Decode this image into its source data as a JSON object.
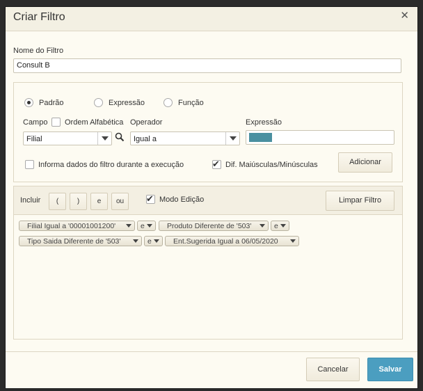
{
  "dialog": {
    "title": "Criar Filtro",
    "close": "✕"
  },
  "name_field": {
    "label": "Nome do Filtro",
    "value": "Consult B"
  },
  "mode_radios": [
    {
      "label": "Padrão",
      "checked": true
    },
    {
      "label": "Expressão",
      "checked": false
    },
    {
      "label": "Função",
      "checked": false
    }
  ],
  "campo": {
    "label": "Campo",
    "value": "Filial"
  },
  "ordem_alfabetica": {
    "label": "Ordem Alfabética",
    "checked": false
  },
  "operador": {
    "label": "Operador",
    "value": "Igual a"
  },
  "expressao": {
    "label": "Expressão",
    "swatch_color": "#4a90a0"
  },
  "options": {
    "informa": {
      "label": "Informa dados do filtro durante a execução",
      "checked": false
    },
    "dif_maiusc": {
      "label": "Dif. Maiúsculas/Minúsculas",
      "checked": true
    }
  },
  "adicionar_label": "Adicionar",
  "toolbar": {
    "incluir_label": "Incluir",
    "buttons": [
      "(",
      ")",
      "e",
      "ou"
    ],
    "modo_edicao": {
      "label": "Modo Edição",
      "checked": true
    },
    "limpar_label": "Limpar Filtro"
  },
  "filter_chips": [
    "Filial Igual a '00001001200'",
    "e",
    "Produto Diferente de '503'",
    "e",
    "Tipo Saida Diferente de '503'",
    "e",
    "Ent.Sugerida Igual a 06/05/2020"
  ],
  "footer": {
    "cancel_label": "Cancelar",
    "save_label": "Salvar"
  },
  "colors": {
    "primary": "#4b9ec0",
    "background": "#fdfbf2"
  }
}
